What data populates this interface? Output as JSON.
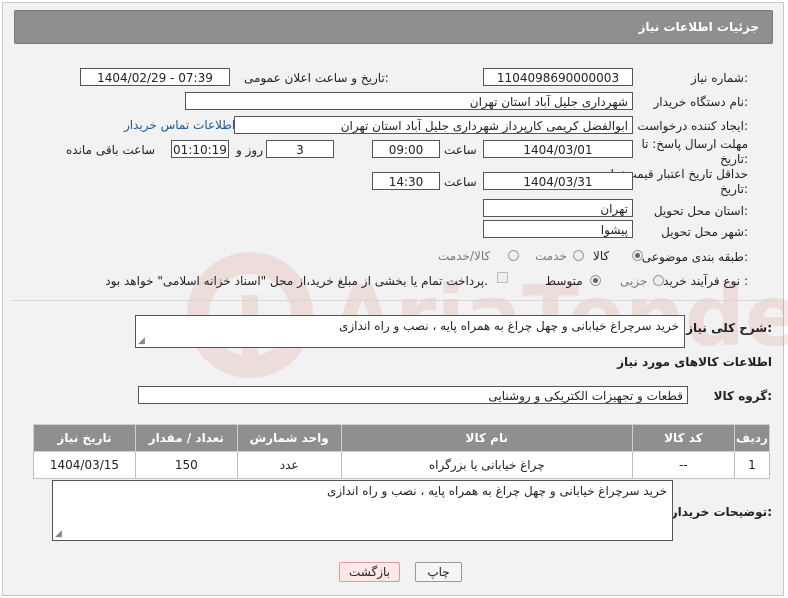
{
  "page": {
    "title": "جزئیات اطلاعات نیاز"
  },
  "fields": {
    "need_number": {
      "label": "شماره نیاز:",
      "value": "1104098690000003"
    },
    "announce_datetime": {
      "label": "تاریخ و ساعت اعلان عمومی:",
      "value": "1404/02/29 - 07:39"
    },
    "buyer_org": {
      "label": "نام دستگاه خریدار:",
      "value": "شهرداری جلیل آباد استان تهران"
    },
    "requester": {
      "label": "ایجاد کننده درخواست:",
      "value": "ابوالفضل کریمی کارپرداز شهرداری جلیل آباد استان تهران",
      "link": "اطلاعات تماس خریدار"
    },
    "reply_deadline": {
      "label": "مهلت ارسال پاسخ: تا تاریخ:",
      "date": "1404/03/01",
      "time_label": "ساعت",
      "time": "09:00",
      "days": "3",
      "days_label": "روز و",
      "remaining": "01:10:19",
      "remaining_label": "ساعت باقی مانده"
    },
    "price_validity": {
      "label": "حداقل تاریخ اعتبار قیمت: تا تاریخ:",
      "date": "1404/03/31",
      "time_label": "ساعت",
      "time": "14:30"
    },
    "delivery_province": {
      "label": "استان محل تحویل:",
      "value": "تهران"
    },
    "delivery_city": {
      "label": "شهر محل تحویل:",
      "value": "پیشوا"
    },
    "category": {
      "label": "طبقه بندی موضوعی:",
      "options": [
        "کالا",
        "خدمت",
        "کالا/خدمت"
      ],
      "selected": "کالا"
    },
    "purchase_process": {
      "label": "نوع فرآیند خرید :",
      "options": [
        "جزیی",
        "متوسط"
      ],
      "selected": "متوسط",
      "payment_note": "پرداخت تمام یا بخشی از مبلغ خرید،از محل \"اسناد خزانه اسلامی\" خواهد بود."
    }
  },
  "summary": {
    "label": "شرح کلی نیاز:",
    "value": "خرید سرچراغ خیابانی و چهل چراغ به همراه پایه ، نصب و راه اندازی"
  },
  "goods_section": {
    "title": "اطلاعات کالاهای مورد نیاز",
    "group_label": "گروه کالا:",
    "group_value": "قطعات و تجهیزات الکتریکی و روشنایی"
  },
  "table": {
    "headers": [
      "ردیف",
      "کد کالا",
      "نام کالا",
      "واحد شمارش",
      "تعداد / مقدار",
      "تاریخ نیاز"
    ],
    "rows": [
      {
        "row": "1",
        "code": "--",
        "name": "چراغ خیابانی یا بزرگراه",
        "unit": "عدد",
        "qty": "150",
        "date": "1404/03/15"
      }
    ]
  },
  "buyer_notes": {
    "label": "توضیحات خریدار:",
    "value": "خرید سرچراغ خیابانی و چهل چراغ به همراه پایه ، نصب و راه اندازی"
  },
  "buttons": {
    "print": "چاپ",
    "back": "بازگشت"
  },
  "watermark": {
    "text": "AriaTender.net",
    "color": "#c0392b"
  }
}
